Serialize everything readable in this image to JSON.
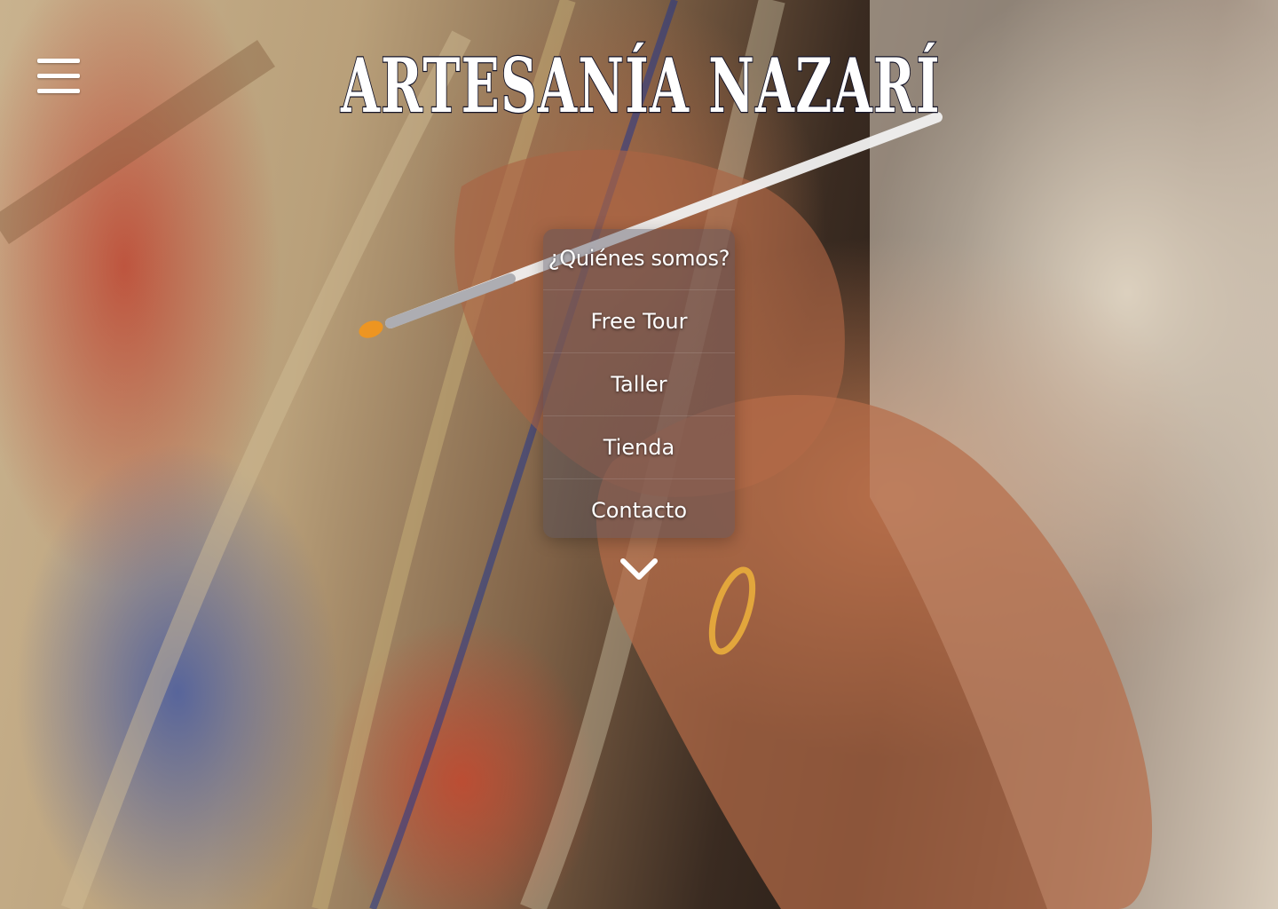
{
  "header": {
    "menu_icon": "hamburger-icon",
    "brand": "ARTESANÍA NAZARÍ"
  },
  "nav": {
    "items": [
      {
        "label": "¿Quiénes somos?"
      },
      {
        "label": "Free Tour"
      },
      {
        "label": "Taller"
      },
      {
        "label": "Tienda"
      },
      {
        "label": "Contacto"
      }
    ]
  },
  "scroll": {
    "icon": "chevron-down-icon"
  }
}
